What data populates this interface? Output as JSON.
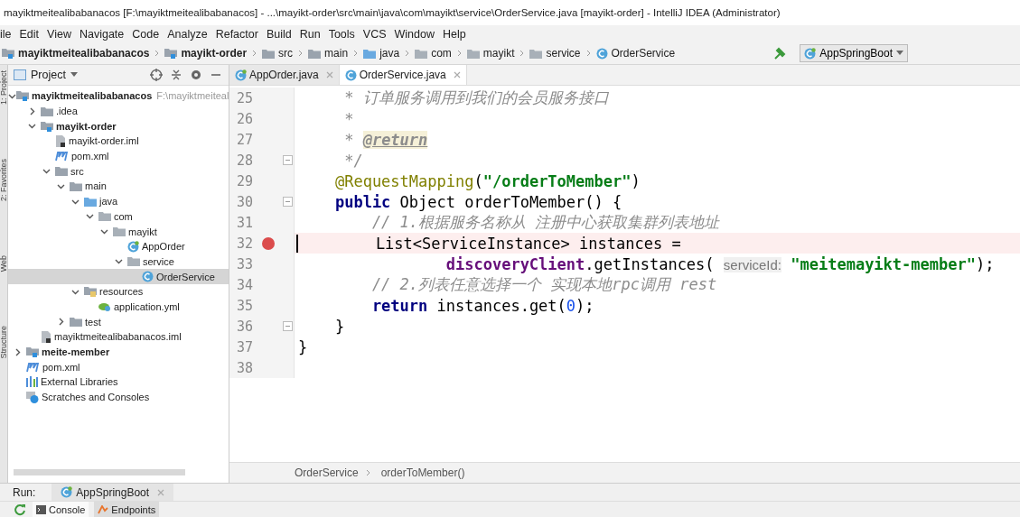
{
  "window": {
    "title": "mayiktmeitealibabanacos [F:\\mayiktmeitealibabanacos] - ...\\mayikt-order\\src\\main\\java\\com\\mayikt\\service\\OrderService.java [mayikt-order] - IntelliJ IDEA (Administrator)"
  },
  "menu": [
    "ile",
    "Edit",
    "View",
    "Navigate",
    "Code",
    "Analyze",
    "Refactor",
    "Build",
    "Run",
    "Tools",
    "VCS",
    "Window",
    "Help"
  ],
  "navigation": [
    {
      "label": "mayiktmeitealibabanacos",
      "kind": "module"
    },
    {
      "label": "mayikt-order",
      "kind": "module"
    },
    {
      "label": "src",
      "kind": "folder"
    },
    {
      "label": "main",
      "kind": "folder"
    },
    {
      "label": "java",
      "kind": "source"
    },
    {
      "label": "com",
      "kind": "package"
    },
    {
      "label": "mayikt",
      "kind": "package"
    },
    {
      "label": "service",
      "kind": "package"
    },
    {
      "label": "OrderService",
      "kind": "class"
    }
  ],
  "run_config": "AppSpringBoot",
  "side_tools": [
    "1: Project",
    "2: Favorites",
    "Web",
    "Structure"
  ],
  "project_panel": {
    "title": "Project",
    "tree": [
      {
        "label": "mayiktmeitealibabanacos",
        "hint": "F:\\mayiktmeiteal",
        "kind": "module",
        "bold": true,
        "expanded": true,
        "selected": false,
        "children": [
          {
            "label": ".idea",
            "kind": "folder",
            "bold": false,
            "expanded": false,
            "selected": false
          },
          {
            "label": "mayikt-order",
            "kind": "module",
            "bold": true,
            "expanded": true,
            "selected": false,
            "children": [
              {
                "label": "mayikt-order.iml",
                "kind": "iml",
                "bold": false,
                "selected": false
              },
              {
                "label": "pom.xml",
                "kind": "maven",
                "bold": false,
                "selected": false
              },
              {
                "label": "src",
                "kind": "folder",
                "bold": false,
                "expanded": true,
                "selected": false,
                "children": [
                  {
                    "label": "main",
                    "kind": "folder",
                    "bold": false,
                    "expanded": true,
                    "selected": false,
                    "children": [
                      {
                        "label": "java",
                        "kind": "source",
                        "bold": false,
                        "expanded": true,
                        "selected": false,
                        "children": [
                          {
                            "label": "com",
                            "kind": "package",
                            "bold": false,
                            "expanded": true,
                            "selected": false,
                            "children": [
                              {
                                "label": "mayikt",
                                "kind": "package",
                                "bold": false,
                                "expanded": true,
                                "selected": false,
                                "children": [
                                  {
                                    "label": "AppOrder",
                                    "kind": "spring-class",
                                    "bold": false,
                                    "selected": false
                                  },
                                  {
                                    "label": "service",
                                    "kind": "package",
                                    "bold": false,
                                    "expanded": true,
                                    "selected": false,
                                    "children": [
                                      {
                                        "label": "OrderService",
                                        "kind": "class",
                                        "bold": false,
                                        "selected": true
                                      }
                                    ]
                                  }
                                ]
                              }
                            ]
                          }
                        ]
                      },
                      {
                        "label": "resources",
                        "kind": "resources",
                        "bold": false,
                        "expanded": true,
                        "selected": false,
                        "children": [
                          {
                            "label": "application.yml",
                            "kind": "yml",
                            "bold": false,
                            "selected": false
                          }
                        ]
                      }
                    ]
                  },
                  {
                    "label": "test",
                    "kind": "folder",
                    "bold": false,
                    "expanded": false,
                    "selected": false
                  }
                ]
              }
            ]
          },
          {
            "label": "mayiktmeitealibabanacos.iml",
            "kind": "iml",
            "bold": false,
            "selected": false
          }
        ]
      },
      {
        "label": "meite-member",
        "kind": "module",
        "bold": true,
        "expanded": false,
        "selected": false
      },
      {
        "label": "pom.xml",
        "kind": "maven",
        "bold": false,
        "selected": false
      },
      {
        "label": "External Libraries",
        "kind": "libraries",
        "bold": false,
        "selected": false
      },
      {
        "label": "Scratches and Consoles",
        "kind": "scratch",
        "bold": false,
        "selected": false
      }
    ]
  },
  "editor_tabs": [
    {
      "label": "AppOrder.java",
      "kind": "spring-class",
      "selected": false
    },
    {
      "label": "OrderService.java",
      "kind": "class",
      "selected": true
    }
  ],
  "code_lines": [
    {
      "number": "25",
      "fold": false,
      "breakpoint": false,
      "current": false,
      "tokens": [
        {
          "kind": "comment",
          "text": "     * 订单服务调用到我们的会员服务接口"
        }
      ]
    },
    {
      "number": "26",
      "fold": false,
      "breakpoint": false,
      "current": false,
      "tokens": [
        {
          "kind": "comment",
          "text": "     *"
        }
      ]
    },
    {
      "number": "27",
      "fold": false,
      "breakpoint": false,
      "current": false,
      "tokens": [
        {
          "kind": "comment",
          "text": "     * "
        },
        {
          "kind": "doctag",
          "text": "@return"
        }
      ]
    },
    {
      "number": "28",
      "fold": true,
      "breakpoint": false,
      "current": false,
      "tokens": [
        {
          "kind": "comment",
          "text": "     */"
        }
      ]
    },
    {
      "number": "29",
      "fold": false,
      "breakpoint": false,
      "current": false,
      "tokens": [
        {
          "kind": "annotation",
          "text": "    @RequestMapping"
        },
        {
          "kind": "plain",
          "text": "("
        },
        {
          "kind": "string",
          "text": "\"/orderToMember\""
        },
        {
          "kind": "plain",
          "text": ")"
        }
      ]
    },
    {
      "number": "30",
      "fold": true,
      "breakpoint": false,
      "current": false,
      "tokens": [
        {
          "kind": "keyword",
          "text": "    public"
        },
        {
          "kind": "plain",
          "text": " Object orderToMember() {"
        }
      ]
    },
    {
      "number": "31",
      "fold": false,
      "breakpoint": false,
      "current": false,
      "tokens": [
        {
          "kind": "comment",
          "text": "        // 1.根据服务名称从 注册中心获取集群列表地址"
        }
      ]
    },
    {
      "number": "32",
      "fold": false,
      "breakpoint": true,
      "current": true,
      "tokens": [
        {
          "kind": "plain",
          "text": "        List<ServiceInstance> instances ="
        }
      ]
    },
    {
      "number": "33",
      "fold": false,
      "breakpoint": false,
      "current": false,
      "tokens": [
        {
          "kind": "field",
          "text": "                discoveryClient"
        },
        {
          "kind": "plain",
          "text": ".getInstances( "
        },
        {
          "kind": "hint",
          "text": "serviceId:"
        },
        {
          "kind": "string",
          "text": " \"meitemayikt-member\""
        },
        {
          "kind": "plain",
          "text": ");"
        }
      ]
    },
    {
      "number": "34",
      "fold": false,
      "breakpoint": false,
      "current": false,
      "tokens": [
        {
          "kind": "comment",
          "text": "        // 2.列表任意选择一个 实现本地rpc调用 rest"
        }
      ]
    },
    {
      "number": "35",
      "fold": false,
      "breakpoint": false,
      "current": false,
      "tokens": [
        {
          "kind": "keyword",
          "text": "        return"
        },
        {
          "kind": "plain",
          "text": " instances.get("
        },
        {
          "kind": "number",
          "text": "0"
        },
        {
          "kind": "plain",
          "text": ");"
        }
      ]
    },
    {
      "number": "36",
      "fold": true,
      "breakpoint": false,
      "current": false,
      "tokens": [
        {
          "kind": "plain",
          "text": "    }"
        }
      ]
    },
    {
      "number": "37",
      "fold": false,
      "breakpoint": false,
      "current": false,
      "tokens": [
        {
          "kind": "plain",
          "text": "}"
        }
      ]
    },
    {
      "number": "38",
      "fold": false,
      "breakpoint": false,
      "current": false
    }
  ],
  "editor_breadcrumb": [
    "OrderService",
    "orderToMember()"
  ],
  "run_panel": {
    "label": "Run:",
    "tab": "AppSpringBoot",
    "tools": [
      {
        "label": "Console",
        "kind": "console",
        "selected": true
      },
      {
        "label": "Endpoints",
        "kind": "endpoints",
        "selected": false
      }
    ]
  }
}
